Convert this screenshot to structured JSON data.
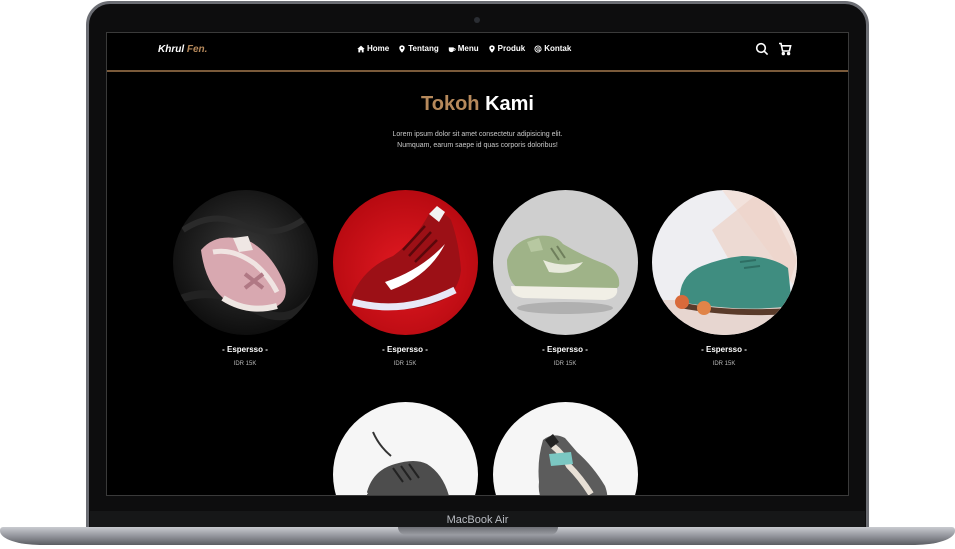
{
  "device": {
    "label": "MacBook Air"
  },
  "navbar": {
    "brand_first": "Khrul",
    "brand_second": "Fen.",
    "links": [
      {
        "label": "Home",
        "icon": "home-icon"
      },
      {
        "label": "Tentang",
        "icon": "map-pin-icon"
      },
      {
        "label": "Menu",
        "icon": "coffee-cup-icon"
      },
      {
        "label": "Produk",
        "icon": "map-pin-icon"
      },
      {
        "label": "Kontak",
        "icon": "at-sign-icon"
      }
    ],
    "actions": [
      "search-icon",
      "shopping-cart-icon"
    ]
  },
  "section": {
    "title_accent": "Tokoh",
    "title_rest": "Kami",
    "intro_line1": "Lorem ipsum dolor sit amet consectetur adipisicing elit.",
    "intro_line2": "Numquam, earum saepe id quas corporis doloribus!"
  },
  "products": [
    {
      "name": "- Espersso -",
      "price": "IDR 15K"
    },
    {
      "name": "- Espersso -",
      "price": "IDR 15K"
    },
    {
      "name": "- Espersso -",
      "price": "IDR 15K"
    },
    {
      "name": "- Espersso -",
      "price": "IDR 15K"
    }
  ],
  "colors": {
    "accent": "#b6895b",
    "background": "#000000",
    "text": "#ffffff"
  }
}
